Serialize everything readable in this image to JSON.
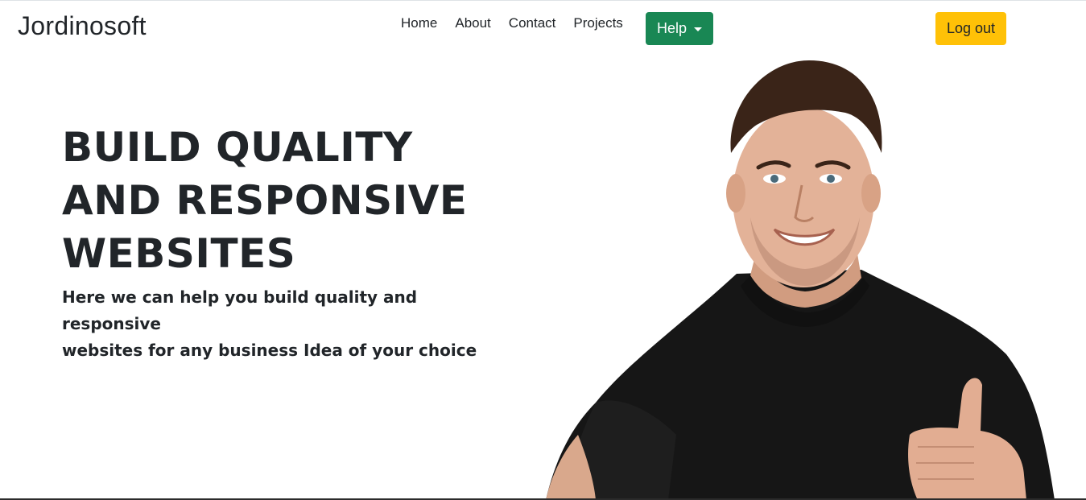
{
  "header": {
    "brand": "Jordinosoft",
    "nav": [
      {
        "label": "Home"
      },
      {
        "label": "About"
      },
      {
        "label": "Contact"
      },
      {
        "label": "Projects"
      }
    ],
    "help_label": "Help",
    "logout_label": "Log out",
    "colors": {
      "help": "#198754",
      "logout": "#ffc107"
    }
  },
  "hero": {
    "title_lines": [
      "BUILD QUALITY",
      "AND RESPONSIVE",
      "WEBSITES"
    ],
    "subtitle_lines": [
      "Here we can help you build quality and responsive",
      "websites for any business Idea of your choice"
    ],
    "image": "smiling-man-black-tshirt-thumbs-up"
  }
}
